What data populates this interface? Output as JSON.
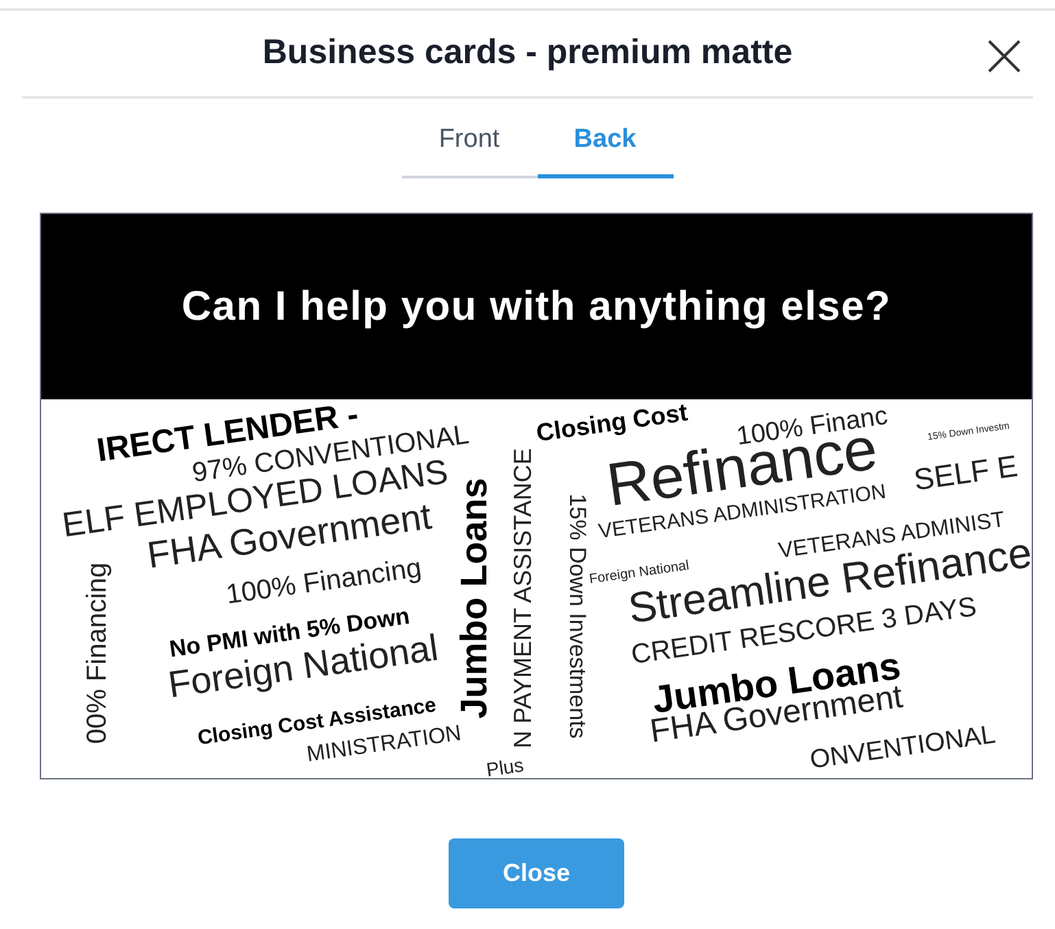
{
  "dialog": {
    "title": "Business cards - premium matte"
  },
  "tabs": [
    {
      "label": "Front",
      "selected": false
    },
    {
      "label": "Back",
      "selected": true
    }
  ],
  "card": {
    "headline": "Can I help you with anything else?",
    "words": [
      {
        "text": "IRECT LENDER -",
        "kind": "bold"
      },
      {
        "text": "97% CONVENTIONAL",
        "kind": "regular"
      },
      {
        "text": "ELF EMPLOYED LOANS",
        "kind": "regular"
      },
      {
        "text": "FHA Government",
        "kind": "regular"
      },
      {
        "text": "100% Financing",
        "kind": "regular"
      },
      {
        "text": "No PMI with 5% Down",
        "kind": "bold"
      },
      {
        "text": "Foreign National",
        "kind": "regular"
      },
      {
        "text": "Closing Cost Assistance",
        "kind": "bold"
      },
      {
        "text": "MINISTRATION",
        "kind": "regular"
      },
      {
        "text": "00% Financing",
        "kind": "regular"
      },
      {
        "text": "Jumbo Loans",
        "kind": "bold"
      },
      {
        "text": "N PAYMENT ASSISTANCE",
        "kind": "regular"
      },
      {
        "text": "15% Down Investments",
        "kind": "regular"
      },
      {
        "text": "Closing Cost",
        "kind": "bold"
      },
      {
        "text": "100% Financ",
        "kind": "regular"
      },
      {
        "text": "15% Down Investm",
        "kind": "regular"
      },
      {
        "text": "Refinance",
        "kind": "regular"
      },
      {
        "text": "SELF E",
        "kind": "regular"
      },
      {
        "text": "VETERANS ADMINISTRATION",
        "kind": "regular"
      },
      {
        "text": "Foreign National",
        "kind": "regular"
      },
      {
        "text": "VETERANS ADMINIST",
        "kind": "regular"
      },
      {
        "text": "Streamline Refinance",
        "kind": "regular"
      },
      {
        "text": "CREDIT RESCORE 3 DAYS",
        "kind": "regular"
      },
      {
        "text": "Jumbo Loans",
        "kind": "bold"
      },
      {
        "text": "FHA Government",
        "kind": "regular"
      },
      {
        "text": "ONVENTIONAL",
        "kind": "regular"
      },
      {
        "text": "Plus",
        "kind": "regular"
      }
    ]
  },
  "footer": {
    "button": "Close"
  }
}
